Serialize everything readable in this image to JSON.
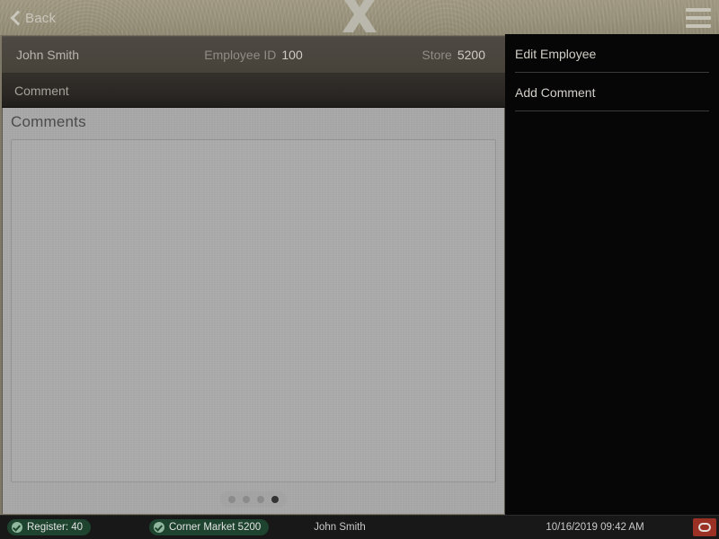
{
  "topbar": {
    "back_label": "Back",
    "logo_glyph": "X",
    "menu_icon": "hamburger-menu-icon"
  },
  "employee_header": {
    "name": "John Smith",
    "employee_id_label": "Employee ID",
    "employee_id_value": "100",
    "store_label": "Store",
    "store_value": "5200"
  },
  "tabs": [
    {
      "label": "Comment",
      "active": true
    }
  ],
  "content": {
    "section_title": "Comments",
    "comments": [],
    "pager": {
      "count": 4,
      "active_index": 3
    }
  },
  "menu": {
    "items": [
      {
        "label": "Edit Employee"
      },
      {
        "label": "Add Comment"
      }
    ]
  },
  "statusbar": {
    "register_badge": "Register: 40",
    "store_badge": "Corner Market 5200",
    "user": "John Smith",
    "datetime": "10/16/2019 09:42 AM",
    "power_icon": "power-button-icon"
  },
  "colors": {
    "topbar_khaki": "#9c957e",
    "header_brown": "#4a4540",
    "tabbar_dark": "#2a2724",
    "content_gray": "#a9a9a9",
    "menu_black": "#060606",
    "status_black": "#181818",
    "badge_green": "#1e4430",
    "power_red": "#9b3024"
  }
}
